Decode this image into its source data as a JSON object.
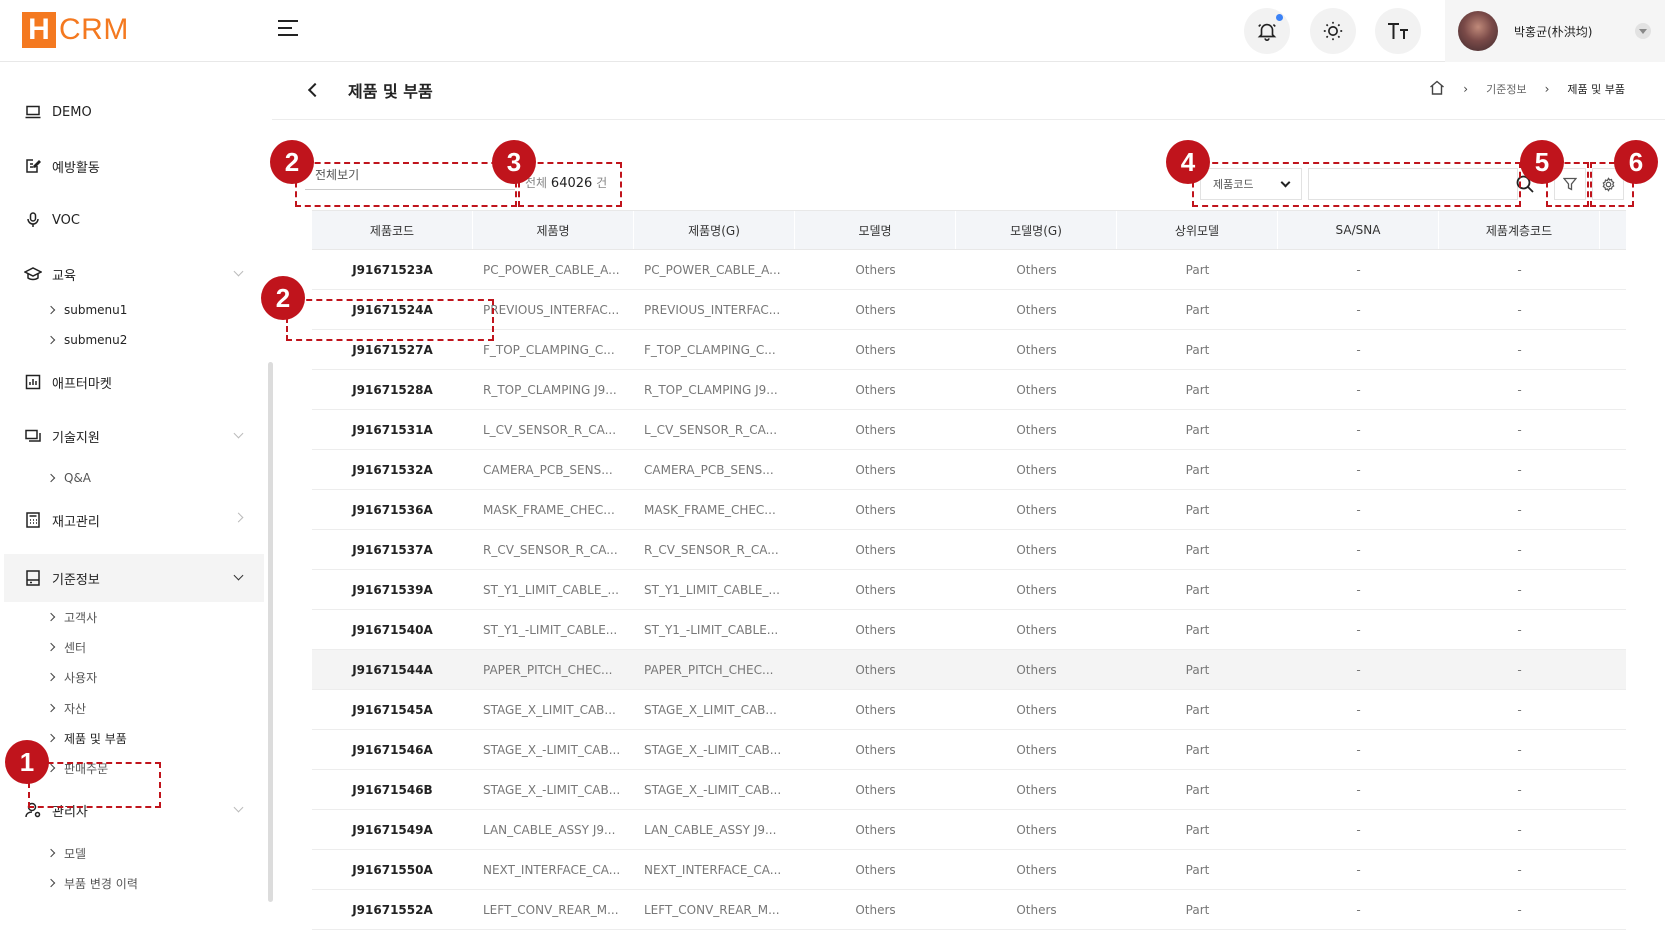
{
  "app": {
    "logo_letter": "H",
    "logo_text": "CRM"
  },
  "header": {
    "user_name": "박홍균(朴洪均)"
  },
  "sidebar": {
    "demo": "DEMO",
    "prevent": "예방활동",
    "voc": "VOC",
    "edu": "교육",
    "edu_sub1": "submenu1",
    "edu_sub2": "submenu2",
    "aftermarket": "애프터마켓",
    "tech": "기술지원",
    "tech_qa": "Q&A",
    "stock": "재고관리",
    "base": "기준정보",
    "base_customer": "고객사",
    "base_center": "센터",
    "base_user": "사용자",
    "base_asset": "자산",
    "base_product": "제품 및 부품",
    "base_order": "판매주문",
    "admin": "관리자",
    "admin_model": "모델",
    "admin_history": "부품 변경 이력"
  },
  "page": {
    "title": "제품 및 부품",
    "breadcrumb": [
      "기준정보",
      "제품 및 부품"
    ]
  },
  "toolbar": {
    "view_select": "전체보기",
    "total_prefix": "전체",
    "total_count": "64026",
    "total_suffix": "건",
    "search_type": "제품코드",
    "search_value": ""
  },
  "table": {
    "columns": [
      "제품코드",
      "제품명",
      "제품명(G)",
      "모델명",
      "모델명(G)",
      "상위모델",
      "SA/SNA",
      "제품계층코드"
    ],
    "rows": [
      [
        "J91671523A",
        "PC_POWER_CABLE_A...",
        "PC_POWER_CABLE_A...",
        "Others",
        "Others",
        "Part",
        "-",
        "-"
      ],
      [
        "J91671524A",
        "PREVIOUS_INTERFAC...",
        "PREVIOUS_INTERFAC...",
        "Others",
        "Others",
        "Part",
        "-",
        "-"
      ],
      [
        "J91671527A",
        "F_TOP_CLAMPING_C...",
        "F_TOP_CLAMPING_C...",
        "Others",
        "Others",
        "Part",
        "-",
        "-"
      ],
      [
        "J91671528A",
        "R_TOP_CLAMPING J9...",
        "R_TOP_CLAMPING J9...",
        "Others",
        "Others",
        "Part",
        "-",
        "-"
      ],
      [
        "J91671531A",
        "L_CV_SENSOR_R_CA...",
        "L_CV_SENSOR_R_CA...",
        "Others",
        "Others",
        "Part",
        "-",
        "-"
      ],
      [
        "J91671532A",
        "CAMERA_PCB_SENS...",
        "CAMERA_PCB_SENS...",
        "Others",
        "Others",
        "Part",
        "-",
        "-"
      ],
      [
        "J91671536A",
        "MASK_FRAME_CHEC...",
        "MASK_FRAME_CHEC...",
        "Others",
        "Others",
        "Part",
        "-",
        "-"
      ],
      [
        "J91671537A",
        "R_CV_SENSOR_R_CA...",
        "R_CV_SENSOR_R_CA...",
        "Others",
        "Others",
        "Part",
        "-",
        "-"
      ],
      [
        "J91671539A",
        "ST_Y1_LIMIT_CABLE_...",
        "ST_Y1_LIMIT_CABLE_...",
        "Others",
        "Others",
        "Part",
        "-",
        "-"
      ],
      [
        "J91671540A",
        "ST_Y1_-LIMIT_CABLE...",
        "ST_Y1_-LIMIT_CABLE...",
        "Others",
        "Others",
        "Part",
        "-",
        "-"
      ],
      [
        "J91671544A",
        "PAPER_PITCH_CHEC...",
        "PAPER_PITCH_CHEC...",
        "Others",
        "Others",
        "Part",
        "-",
        "-"
      ],
      [
        "J91671545A",
        "STAGE_X_LIMIT_CAB...",
        "STAGE_X_LIMIT_CAB...",
        "Others",
        "Others",
        "Part",
        "-",
        "-"
      ],
      [
        "J91671546A",
        "STAGE_X_-LIMIT_CAB...",
        "STAGE_X_-LIMIT_CAB...",
        "Others",
        "Others",
        "Part",
        "-",
        "-"
      ],
      [
        "J91671546B",
        "STAGE_X_-LIMIT_CAB...",
        "STAGE_X_-LIMIT_CAB...",
        "Others",
        "Others",
        "Part",
        "-",
        "-"
      ],
      [
        "J91671549A",
        "LAN_CABLE_ASSY J9...",
        "LAN_CABLE_ASSY J9...",
        "Others",
        "Others",
        "Part",
        "-",
        "-"
      ],
      [
        "J91671550A",
        "NEXT_INTERFACE_CA...",
        "NEXT_INTERFACE_CA...",
        "Others",
        "Others",
        "Part",
        "-",
        "-"
      ],
      [
        "J91671552A",
        "LEFT_CONV_REAR_M...",
        "LEFT_CONV_REAR_M...",
        "Others",
        "Others",
        "Part",
        "-",
        "-"
      ]
    ]
  },
  "annotations": [
    "1",
    "2",
    "3",
    "2",
    "4",
    "5",
    "6"
  ],
  "colors": {
    "brand": "#f47920",
    "annotation": "#c0141c",
    "header_bg": "#f3f5f8",
    "notif_dot": "#3b82f6"
  }
}
